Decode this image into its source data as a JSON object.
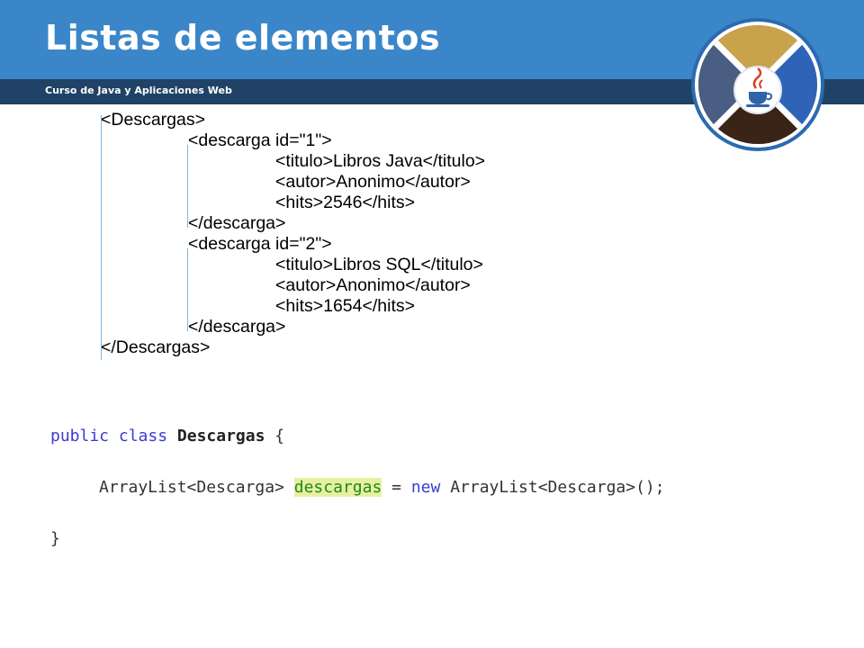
{
  "slide": {
    "title": "Listas de elementos",
    "subtitle": "Curso de Java y Aplicaciones Web"
  },
  "logo": {
    "icon": "java-logo-icon"
  },
  "xml_lines": [
    "<Descargas>",
    "<descarga id=\"1\">",
    "<titulo>Libros Java</titulo>",
    "<autor>Anonimo</autor>",
    "<hits>2546</hits>",
    "</descarga>",
    "<descarga id=\"2\">",
    "<titulo>Libros SQL</titulo>",
    "<autor>Anonimo</autor>",
    "<hits>1654</hits>",
    "</descarga>",
    "</Descargas>"
  ],
  "code": {
    "kw_public": "public",
    "kw_class": "class",
    "class_name": "Descargas",
    "open_brace": "{",
    "decl_type": "ArrayList<Descarga>",
    "var_name": "descargas",
    "equals": "=",
    "kw_new": "new",
    "ctor_call": "ArrayList<Descarga>();",
    "close_brace": "}"
  },
  "colors": {
    "header_blue": "#3b86c8",
    "subtitle_navy": "#1f4266",
    "keyword_blue": "#3b3bd6",
    "highlight_bg": "#e8f0a0"
  }
}
